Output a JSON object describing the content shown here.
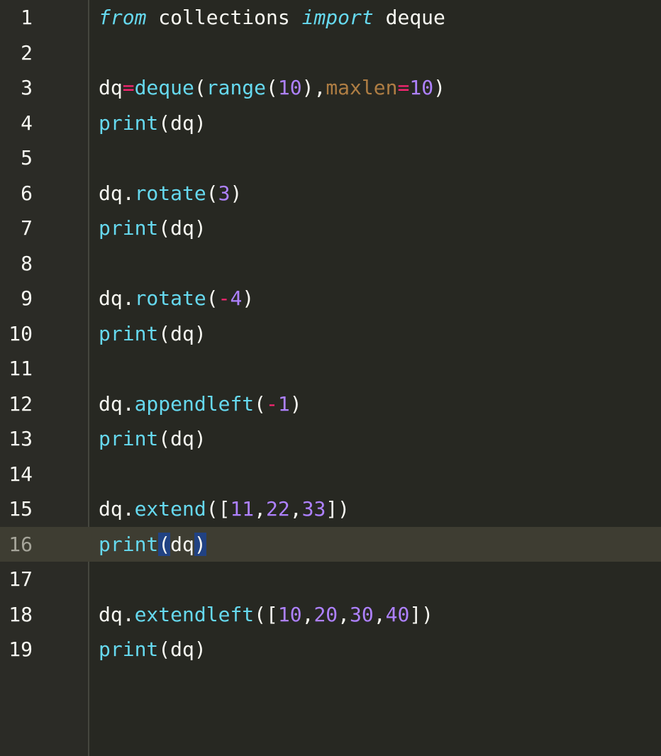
{
  "editor": {
    "current_line": 16,
    "lines": [
      {
        "n": "1",
        "tokens": [
          {
            "t": "from",
            "c": "kw"
          },
          {
            "t": " collections ",
            "c": ""
          },
          {
            "t": "import",
            "c": "kw"
          },
          {
            "t": " deque",
            "c": ""
          }
        ]
      },
      {
        "n": "2",
        "tokens": []
      },
      {
        "n": "3",
        "tokens": [
          {
            "t": "dq",
            "c": ""
          },
          {
            "t": "=",
            "c": "op"
          },
          {
            "t": "deque",
            "c": "fn"
          },
          {
            "t": "(",
            "c": ""
          },
          {
            "t": "range",
            "c": "fn"
          },
          {
            "t": "(",
            "c": ""
          },
          {
            "t": "10",
            "c": "num"
          },
          {
            "t": "),",
            "c": ""
          },
          {
            "t": "maxlen",
            "c": "param"
          },
          {
            "t": "=",
            "c": "op"
          },
          {
            "t": "10",
            "c": "num"
          },
          {
            "t": ")",
            "c": ""
          }
        ]
      },
      {
        "n": "4",
        "tokens": [
          {
            "t": "print",
            "c": "fn"
          },
          {
            "t": "(dq)",
            "c": ""
          }
        ]
      },
      {
        "n": "5",
        "tokens": []
      },
      {
        "n": "6",
        "tokens": [
          {
            "t": "dq.",
            "c": ""
          },
          {
            "t": "rotate",
            "c": "fn"
          },
          {
            "t": "(",
            "c": ""
          },
          {
            "t": "3",
            "c": "num"
          },
          {
            "t": ")",
            "c": ""
          }
        ]
      },
      {
        "n": "7",
        "tokens": [
          {
            "t": "print",
            "c": "fn"
          },
          {
            "t": "(dq)",
            "c": ""
          }
        ]
      },
      {
        "n": "8",
        "tokens": []
      },
      {
        "n": "9",
        "tokens": [
          {
            "t": "dq.",
            "c": ""
          },
          {
            "t": "rotate",
            "c": "fn"
          },
          {
            "t": "(",
            "c": ""
          },
          {
            "t": "-",
            "c": "op"
          },
          {
            "t": "4",
            "c": "num"
          },
          {
            "t": ")",
            "c": ""
          }
        ]
      },
      {
        "n": "10",
        "tokens": [
          {
            "t": "print",
            "c": "fn"
          },
          {
            "t": "(dq)",
            "c": ""
          }
        ]
      },
      {
        "n": "11",
        "tokens": []
      },
      {
        "n": "12",
        "tokens": [
          {
            "t": "dq.",
            "c": ""
          },
          {
            "t": "appendleft",
            "c": "fn"
          },
          {
            "t": "(",
            "c": ""
          },
          {
            "t": "-",
            "c": "op"
          },
          {
            "t": "1",
            "c": "num"
          },
          {
            "t": ")",
            "c": ""
          }
        ]
      },
      {
        "n": "13",
        "tokens": [
          {
            "t": "print",
            "c": "fn"
          },
          {
            "t": "(dq)",
            "c": ""
          }
        ]
      },
      {
        "n": "14",
        "tokens": []
      },
      {
        "n": "15",
        "tokens": [
          {
            "t": "dq.",
            "c": ""
          },
          {
            "t": "extend",
            "c": "fn"
          },
          {
            "t": "([",
            "c": ""
          },
          {
            "t": "11",
            "c": "num"
          },
          {
            "t": ",",
            "c": ""
          },
          {
            "t": "22",
            "c": "num"
          },
          {
            "t": ",",
            "c": ""
          },
          {
            "t": "33",
            "c": "num"
          },
          {
            "t": "])",
            "c": ""
          }
        ]
      },
      {
        "n": "16",
        "tokens": [
          {
            "t": "print",
            "c": "fn"
          },
          {
            "t": "(",
            "c": "bm"
          },
          {
            "t": "dq",
            "c": ""
          },
          {
            "t": ")",
            "c": "bm"
          }
        ]
      },
      {
        "n": "17",
        "tokens": []
      },
      {
        "n": "18",
        "tokens": [
          {
            "t": "dq.",
            "c": ""
          },
          {
            "t": "extendleft",
            "c": "fn"
          },
          {
            "t": "([",
            "c": ""
          },
          {
            "t": "10",
            "c": "num"
          },
          {
            "t": ",",
            "c": ""
          },
          {
            "t": "20",
            "c": "num"
          },
          {
            "t": ",",
            "c": ""
          },
          {
            "t": "30",
            "c": "num"
          },
          {
            "t": ",",
            "c": ""
          },
          {
            "t": "40",
            "c": "num"
          },
          {
            "t": "])",
            "c": ""
          }
        ]
      },
      {
        "n": "19",
        "tokens": [
          {
            "t": "print",
            "c": "fn"
          },
          {
            "t": "(dq)",
            "c": ""
          }
        ]
      }
    ]
  },
  "colors": {
    "background": "#272822",
    "gutter": "#2b2b26",
    "current_line": "#3e3d32",
    "keyword": "#66d9ef",
    "number": "#ae81ff",
    "operator": "#f92672",
    "parameter": "#c0603a",
    "bracket_match": "#214283",
    "text": "#f8f8f2"
  }
}
